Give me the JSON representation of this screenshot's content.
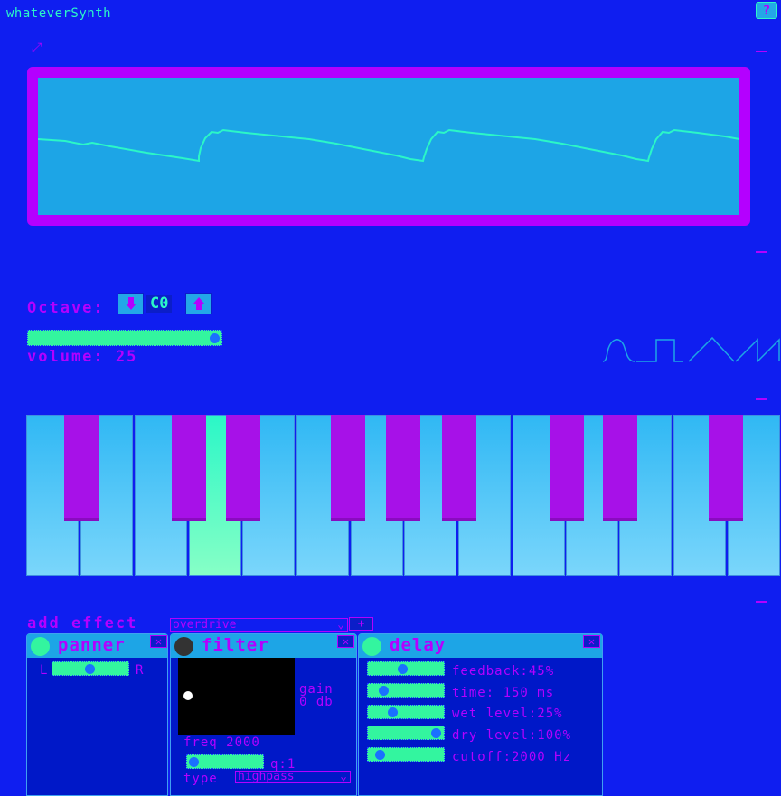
{
  "app": {
    "title": "whateverSynth",
    "help_label": "?"
  },
  "controls": {
    "octave_label": "Octave:",
    "octave_value": "C0",
    "octave_down_icon": "arrow-down-icon",
    "octave_up_icon": "arrow-up-icon",
    "volume_label": "volume: 25",
    "volume_value_fraction": 0.97
  },
  "waveforms": [
    "sine",
    "square",
    "triangle",
    "sawtooth"
  ],
  "keyboard": {
    "white_keys": 14,
    "active_white_key_index": 3
  },
  "effects": {
    "add_label": "add effect",
    "selected_effect": "overdrive",
    "add_button_label": "+",
    "panels": {
      "panner": {
        "title": "panner",
        "left_label": "L",
        "right_label": "R",
        "close_label": "✕",
        "pan_fraction": 0.5
      },
      "filter": {
        "title": "filter",
        "close_label": "✕",
        "gain_label": "gain",
        "gain_value": "0 db",
        "freq_label": "freq 2000",
        "q_label": "q:1",
        "type_label": "type",
        "type_value": "highpass",
        "q_fraction": 0.08
      },
      "delay": {
        "title": "delay",
        "close_label": "✕",
        "params": [
          {
            "label": "feedback:45%",
            "fraction": 0.45
          },
          {
            "label": "time: 150 ms",
            "fraction": 0.2
          },
          {
            "label": "wet level:25%",
            "fraction": 0.3
          },
          {
            "label": "dry level:100%",
            "fraction": 0.9
          },
          {
            "label": "cutoff:2000 Hz",
            "fraction": 0.1
          }
        ]
      }
    }
  },
  "colors": {
    "background": "#0f1ef0",
    "accent": "#b400ff",
    "green": "#2bf7c7",
    "scope": "#1da5e6"
  }
}
